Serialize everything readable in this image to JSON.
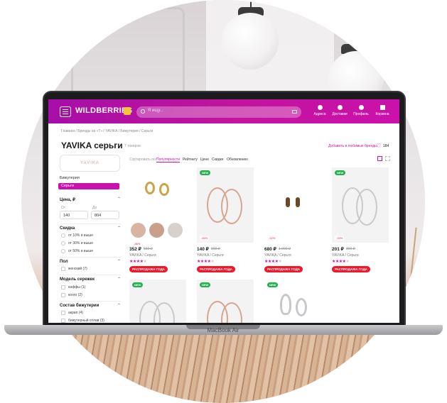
{
  "header": {
    "logo": "WILDBERRIES",
    "search_placeholder": "Я ищу...",
    "nav": [
      {
        "label": "Адреса",
        "icon": "location-pin-icon"
      },
      {
        "label": "Доставки",
        "icon": "delivery-icon"
      },
      {
        "label": "Профиль",
        "icon": "profile-icon"
      },
      {
        "label": "Корзина",
        "icon": "cart-icon"
      }
    ]
  },
  "breadcrumb": "Главная  /  Бренды на «Т»  /  YAVIKA  /  Бижутерия  /  Серьги",
  "page": {
    "title": "YAVIKA серьги",
    "count": "7 товаров",
    "favorite_label": "Добавить в любимые бренды",
    "favorite_count": "184"
  },
  "sidebar": {
    "brand_logo": "YAVIKA",
    "category": "Бижутерия",
    "selected": "Серьги",
    "price": {
      "title": "Цена, ₽",
      "from_label": "От",
      "to_label": "До",
      "from": "140",
      "to": "804"
    },
    "discount": {
      "title": "Скидка",
      "options": [
        "от 10% и выше",
        "от 30% и выше",
        "от 50% и выше"
      ]
    },
    "gender": {
      "title": "Пол",
      "options": [
        "женский (7)"
      ]
    },
    "model": {
      "title": "Модель сережек",
      "options": [
        "каффы (1)",
        "конго (2)"
      ]
    },
    "material": {
      "title": "Состав бижутерии",
      "options": [
        "акрил (4)",
        "бижутерный сплав (3)"
      ]
    }
  },
  "sort": {
    "label": "Сортировать по:",
    "options": [
      "Популярности",
      "Рейтингу",
      "Цене",
      "Скидке",
      "Обновлению"
    ]
  },
  "products": [
    {
      "price": "352 ₽",
      "old_price": "550 ₽",
      "brand": "YAVIKA / Серьги",
      "stars": 4,
      "discount": "-36%",
      "sale": "РАСПРОДАЖА ГОДА",
      "new": false
    },
    {
      "price": "140 ₽",
      "old_price": "300 ₽",
      "brand": "YAVIKA / Серьги",
      "stars": 4,
      "discount": "-53%",
      "sale": "РАСПРОДАЖА ГОДА",
      "new": true
    },
    {
      "price": "680 ₽",
      "old_price": "1 000 ₽",
      "brand": "YAVIKA / Серьги",
      "stars": 4,
      "discount": "-32%",
      "sale": "РАСПРОДАЖА ГОДА",
      "new": false
    },
    {
      "price": "201 ₽",
      "old_price": "300 ₽",
      "brand": "YAVIKA / Серьги",
      "stars": 4,
      "discount": "-33%",
      "sale": "РАСПРОДАЖА ГОДА",
      "new": true
    },
    {
      "new": true
    },
    {
      "new": true
    },
    {
      "new": false
    }
  ],
  "laptop_label": "MacBook Air"
}
